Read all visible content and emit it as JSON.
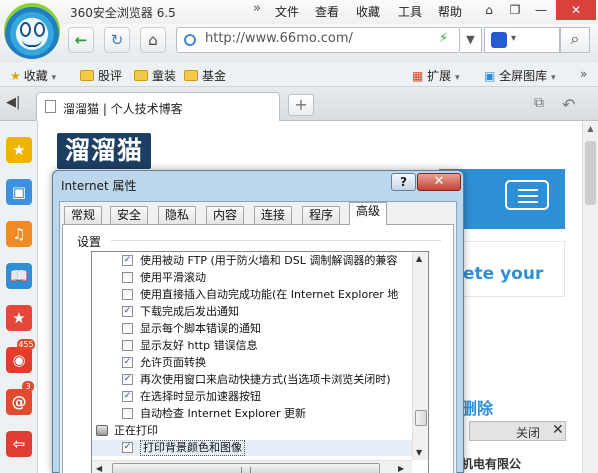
{
  "app": {
    "title": "360安全浏览器 6.5",
    "menu_chevron": "»",
    "menu": [
      "文件",
      "查看",
      "收藏",
      "工具",
      "帮助"
    ],
    "window_buttons": {
      "pin": "⌂",
      "restore": "❐",
      "minimize": "—",
      "close": "✕"
    }
  },
  "nav": {
    "back_icon": "←",
    "refresh_icon": "↻",
    "home_icon": "⌂",
    "url": "http://www.66mo.com/",
    "speed_icon": "⚡",
    "dropdown_icon": "▼",
    "search_engine_icon": "🐾",
    "search_dropdown_icon": "▾",
    "search_icon": "⌕"
  },
  "favorites": {
    "favorites_label": "收藏",
    "folders": [
      "股评",
      "童装",
      "基金"
    ],
    "extensions_label": "扩展",
    "gallery_label": "全屏图库",
    "more_icon": "»"
  },
  "tabs": {
    "active_title": "溜溜猫 | 个人技术博客",
    "new_tab_icon": "+",
    "sidebar_toggle_icon": "◀|"
  },
  "sidebar": {
    "icons": [
      {
        "name": "favorites-star-icon",
        "glyph": "★",
        "color": "#f0b400"
      },
      {
        "name": "game-icon",
        "glyph": "▣",
        "color": "#3d8fe0"
      },
      {
        "name": "music-icon",
        "glyph": "♫",
        "color": "#f08a24"
      },
      {
        "name": "reader-icon",
        "glyph": "📖",
        "color": "#2f8fd6"
      },
      {
        "name": "shop-icon",
        "glyph": "★",
        "color": "#e8463a"
      },
      {
        "name": "weibo-icon",
        "glyph": "◉",
        "color": "#e33b2c"
      },
      {
        "name": "mail-icon",
        "glyph": "@",
        "color": "#e14b2d"
      },
      {
        "name": "exit-icon",
        "glyph": "⇦",
        "color": "#e03c31"
      }
    ],
    "weibo_badge": "455",
    "mail_badge": "3"
  },
  "page": {
    "site_logo": "溜溜猫",
    "promo_text": "ete your",
    "delete_text": "删除",
    "ad_close": "关闭",
    "ad_close_x": "✕",
    "ad_text": "机电有限公"
  },
  "dialog": {
    "title": "Internet 属性",
    "help_label": "?",
    "close_label": "✕",
    "tabs": [
      "常规",
      "安全",
      "隐私",
      "内容",
      "连接",
      "程序",
      "高级"
    ],
    "active_tab": "高级",
    "section_label": "设置",
    "settings": [
      {
        "text": "使用被动 FTP (用于防火墙和 DSL 调制解调器的兼容",
        "checked": true
      },
      {
        "text": "使用平滑滚动",
        "checked": false
      },
      {
        "text": "使用直接插入自动完成功能(在 Internet Explorer 地",
        "checked": false
      },
      {
        "text": "下载完成后发出通知",
        "checked": true
      },
      {
        "text": "显示每个脚本错误的通知",
        "checked": false
      },
      {
        "text": "显示友好 http 错误信息",
        "checked": false
      },
      {
        "text": "允许页面转换",
        "checked": true
      },
      {
        "text": "再次使用窗口来启动快捷方式(当选项卡浏览关闭时)",
        "checked": true
      },
      {
        "text": "在选择时显示加速器按钮",
        "checked": true
      },
      {
        "text": "自动检查 Internet Explorer 更新",
        "checked": false
      }
    ],
    "printing_header": "正在打印",
    "print_option": {
      "text": "打印背景颜色和图像",
      "checked": true
    }
  }
}
